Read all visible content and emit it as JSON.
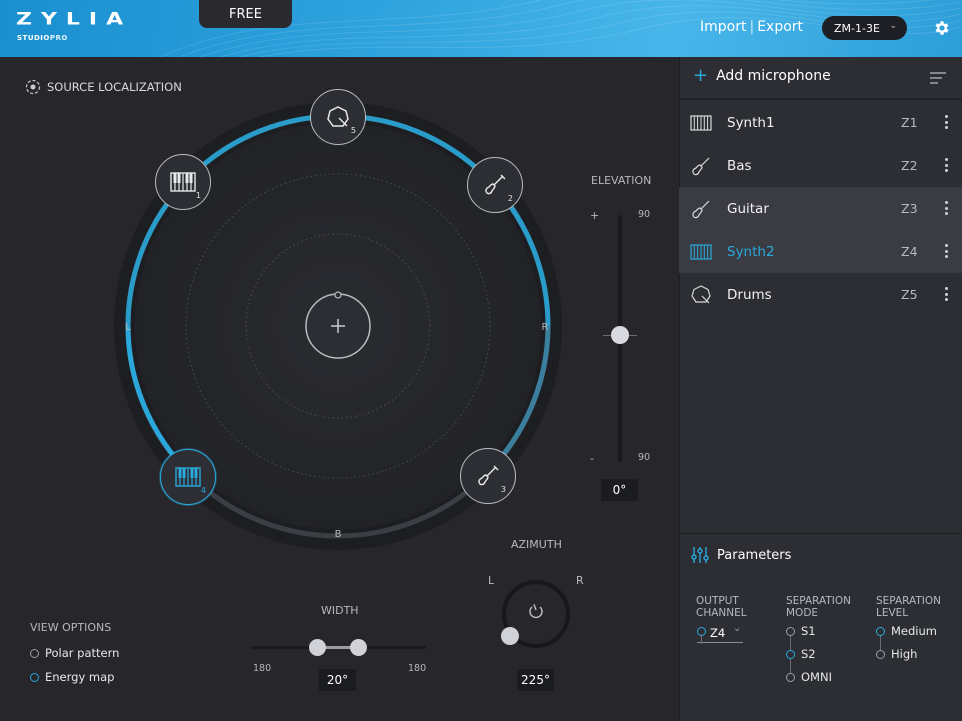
{
  "header": {
    "logo": "ZYLIA",
    "logo_sub_a": "STUDIO",
    "logo_sub_b": "PRO",
    "free_tab": "FREE",
    "import_label": "Import",
    "export_label": "Export",
    "device": "ZM-1-3E",
    "settings_icon": "gear-icon"
  },
  "localization": {
    "title": "SOURCE LOCALIZATION",
    "label_l": "L",
    "label_r": "R",
    "label_b": "B",
    "sources": [
      {
        "num": "5",
        "icon": "drum-icon"
      },
      {
        "num": "1",
        "icon": "keyboard-icon"
      },
      {
        "num": "2",
        "icon": "guitar-icon"
      },
      {
        "num": "4",
        "icon": "keyboard-icon"
      },
      {
        "num": "3",
        "icon": "guitar-icon"
      }
    ]
  },
  "elevation": {
    "title": "ELEVATION",
    "plus": "+",
    "minus": "-",
    "max": "90",
    "min": "90",
    "value": "0°"
  },
  "view_options": {
    "title": "VIEW OPTIONS",
    "options": [
      {
        "label": "Polar pattern",
        "selected": false
      },
      {
        "label": "Energy map",
        "selected": true
      }
    ]
  },
  "width": {
    "title": "WIDTH",
    "min_label": "180",
    "max_label": "180",
    "value": "20°"
  },
  "azimuth": {
    "title": "AZIMUTH",
    "label_l": "L",
    "label_r": "R",
    "value": "225°"
  },
  "mic_panel": {
    "add_label": "Add microphone",
    "items": [
      {
        "name": "Synth1",
        "channel": "Z1",
        "icon": "keyboard-icon"
      },
      {
        "name": "Bas",
        "channel": "Z2",
        "icon": "guitar-icon"
      },
      {
        "name": "Guitar",
        "channel": "Z3",
        "icon": "guitar-icon"
      },
      {
        "name": "Synth2",
        "channel": "Z4",
        "icon": "keyboard-icon"
      },
      {
        "name": "Drums",
        "channel": "Z5",
        "icon": "drum-icon"
      }
    ]
  },
  "parameters": {
    "title": "Parameters",
    "output_channel_title_1": "OUTPUT",
    "output_channel_title_2": "CHANNEL",
    "output_channel_value": "Z4",
    "separation_mode_title_1": "SEPARATION",
    "separation_mode_title_2": "MODE",
    "separation_modes": [
      "S1",
      "S2",
      "OMNI"
    ],
    "separation_mode_selected": "S2",
    "separation_level_title_1": "SEPARATION",
    "separation_level_title_2": "LEVEL",
    "separation_levels": [
      "Medium",
      "High"
    ],
    "separation_level_selected": "Medium"
  },
  "colors": {
    "accent": "#2aa8dc",
    "panel_bg": "#26262b",
    "sidebar_bg": "#2d2e33"
  }
}
